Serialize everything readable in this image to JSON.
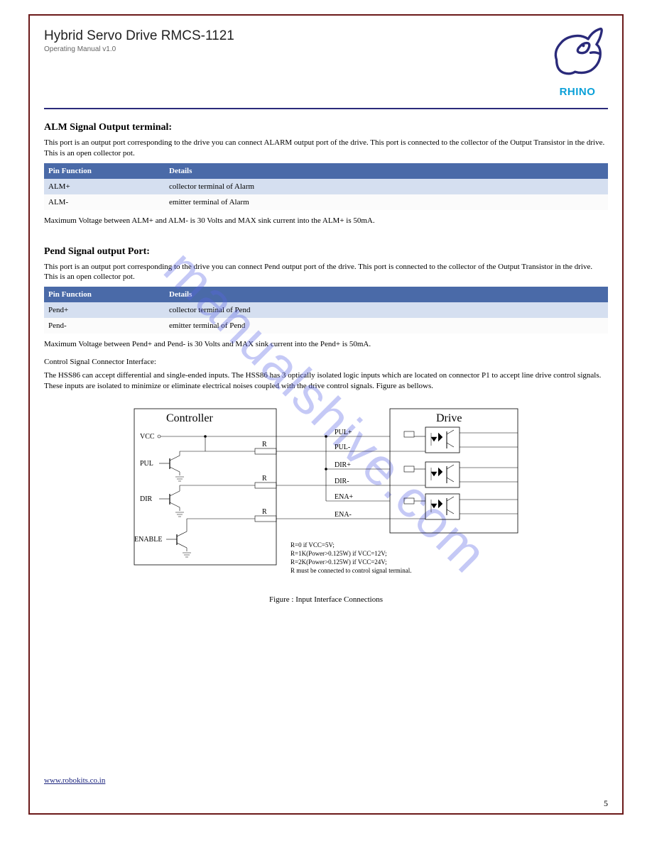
{
  "header": {
    "title": "Hybrid Servo Drive RMCS-1121",
    "subtitle": "Operating Manual v1.0",
    "brand": "RHINO"
  },
  "watermark": "manualshive.com",
  "section1": {
    "title": "ALM Signal Output terminal:",
    "intro": "This port is an output port corresponding to the drive you can connect ALARM output port of the drive. This port is connected to the collector of the Output Transistor in the drive. This is an open collector pot.",
    "table": {
      "headers": [
        "Pin Function",
        "Details"
      ],
      "rows": [
        [
          "ALM+",
          "collector terminal of Alarm"
        ],
        [
          "ALM-",
          "emitter terminal of Alarm"
        ]
      ]
    },
    "footer": "Maximum Voltage between ALM+ and ALM- is 30 Volts and MAX sink current into the ALM+ is 50mA."
  },
  "section2": {
    "title": "Pend Signal output Port:",
    "intro": "This port is an output port corresponding to the drive you can connect Pend output port of the drive. This port is connected to the collector of the Output Transistor in the drive. This is an open collector pot.",
    "table": {
      "headers": [
        "Pin Function",
        "Details"
      ],
      "rows": [
        [
          "Pend+",
          "collector terminal of Pend"
        ],
        [
          "Pend-",
          "emitter terminal of Pend"
        ]
      ]
    },
    "footer1": "Maximum Voltage between Pend+ and Pend- is 30 Volts and MAX sink current into the Pend+ is 50mA.",
    "footer2": "Control Signal Connector Interface:",
    "footer3": "The HSS86 can accept differential and single-ended inputs. The HSS86 has 3 optically isolated logic inputs which are located on connector P1 to accept line drive control signals. These inputs are isolated to minimize or eliminate electrical noises coupled with the drive control signals. Figure as bellows."
  },
  "diagram": {
    "controllerLabel": "Controller",
    "driveLabel": "Drive",
    "vcc": "VCC",
    "pul": "PUL",
    "dir": "DIR",
    "enable": "ENABLE",
    "r": "R",
    "pulp": "PUL+",
    "pulm": "PUL-",
    "dirp": "DIR+",
    "dirm": "DIR-",
    "enap": "ENA+",
    "enam": "ENA-",
    "note1": "R=0 if VCC=5V;",
    "note2": "R=1K(Power>0.125W) if VCC=12V;",
    "note3": "R=2K(Power>0.125W) if VCC=24V;",
    "note4": "R must be connected to control signal terminal.",
    "caption": "Figure : Input Interface Connections"
  },
  "footer": {
    "link": "www.robokits.co.in",
    "page": "5"
  }
}
